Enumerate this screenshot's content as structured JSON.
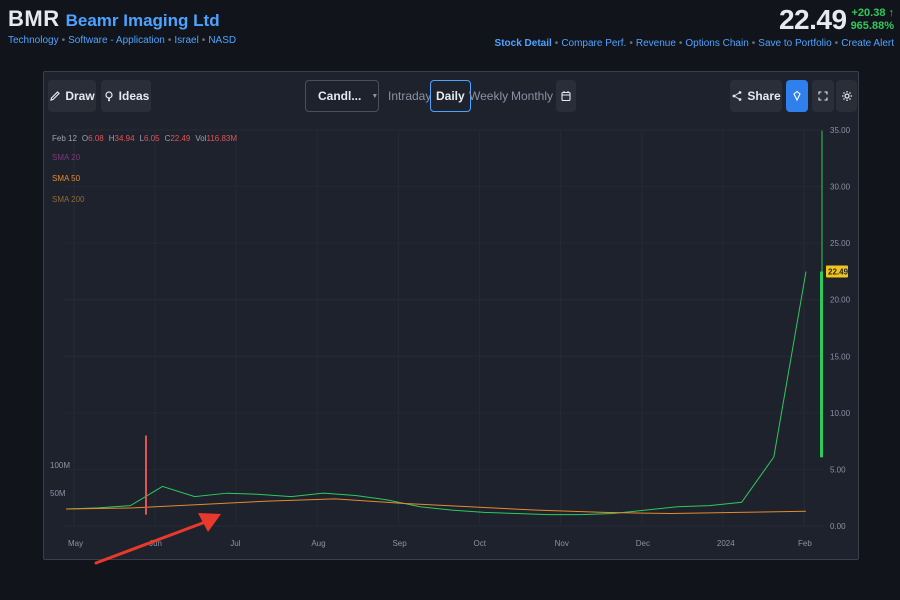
{
  "header": {
    "ticker": "BMR",
    "company": "Beamr Imaging Ltd",
    "sectors": [
      "Technology",
      "Software - Application",
      "Israel",
      "NASD"
    ],
    "price": "22.49",
    "change": "+20.38",
    "change_arrow": "↑",
    "change_pct": "965.88%",
    "links": [
      "Stock Detail",
      "Compare Perf.",
      "Revenue",
      "Options Chain",
      "Save to Portfolio",
      "Create Alert"
    ]
  },
  "toolbar": {
    "draw": "Draw",
    "ideas": "Ideas",
    "chart_type": "Candl...",
    "timeframes": [
      "Intraday",
      "Daily",
      "Weekly",
      "Monthly"
    ],
    "active_timeframe": "Daily",
    "share": "Share"
  },
  "legend": {
    "date": "Feb 12",
    "o_label": "O",
    "o": "6.08",
    "h_label": "H",
    "h": "34.94",
    "l_label": "L",
    "l": "6.05",
    "c_label": "C",
    "c": "22.49",
    "vol_label": "Vol",
    "vol": "116.83M",
    "sma20": "SMA 20",
    "sma50": "SMA 50",
    "sma200": "SMA 200"
  },
  "colors": {
    "up": "#2ec95c",
    "down": "#e05454",
    "sma20": "#7b3a7c",
    "sma50": "#e58a2e",
    "sma200": "#8a6a3a",
    "accent": "#4da3ff",
    "annotation_arrow": "#e8392c"
  },
  "chart_data": {
    "type": "line",
    "x_ticks": [
      "May",
      "Jun",
      "Jul",
      "Aug",
      "Sep",
      "Oct",
      "Nov",
      "Dec",
      "2024",
      "Feb"
    ],
    "y_ticks": [
      "35.00",
      "30.00",
      "25.00",
      "20.00",
      "15.00",
      "10.00",
      "5.00",
      "0.00"
    ],
    "y_lim": [
      0,
      35
    ],
    "volume_ticks": [
      "100M",
      "50M"
    ],
    "last_price_label": "22.49",
    "series": [
      {
        "name": "SMA 50",
        "values": [
          1.5,
          1.6,
          1.9,
          2.2,
          2.4,
          2.0,
          1.7,
          1.4,
          1.2,
          1.1,
          1.2,
          1.3
        ]
      }
    ],
    "price_path": [
      1.5,
      1.6,
      1.8,
      3.5,
      2.6,
      2.9,
      2.8,
      2.6,
      2.9,
      2.7,
      2.3,
      1.7,
      1.4,
      1.2,
      1.1,
      1.0,
      1.0,
      1.1,
      1.4,
      1.7,
      1.8,
      2.1,
      6.1,
      22.49
    ],
    "spike": {
      "date": "Feb 12",
      "open": 6.08,
      "high": 34.94,
      "low": 6.05,
      "close": 22.49
    }
  }
}
